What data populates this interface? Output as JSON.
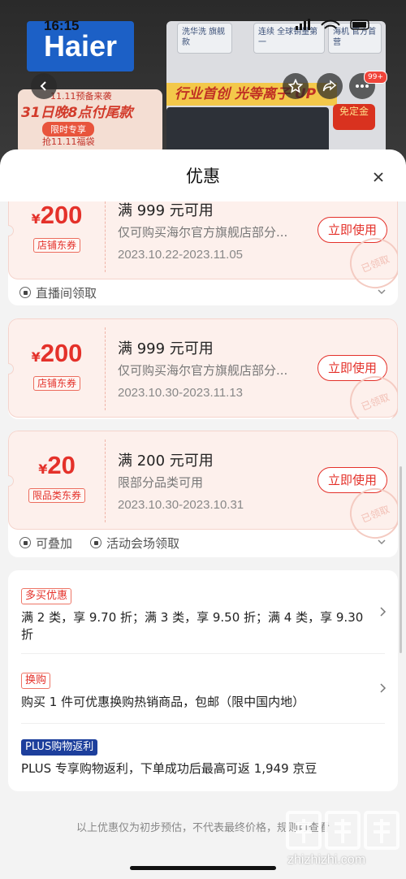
{
  "status_bar": {
    "time": "16:15"
  },
  "background": {
    "brand": "Haier",
    "promo_line1": "11.11预备来袭",
    "promo_line2": "31日晚8点付尾款",
    "promo_tag": "限时专享",
    "promo_line3": "抢11.11福袋",
    "tile1": "洗华洗 旗舰款",
    "tile2": "连续 全球销量第一",
    "tile3": "海机 官方首营",
    "slogan": "行业首创 光等离子 UP",
    "discount": "免定金",
    "badge": "99+"
  },
  "sheet": {
    "title": "优惠",
    "close_icon": "close-icon"
  },
  "coupons": [
    {
      "currency": "¥",
      "amount": "200",
      "tag": "店铺东券",
      "condition": "满 999 元可用",
      "desc": "仅可购买海尔官方旗舰店部分...",
      "date": "2023.10.22-2023.11.05",
      "action": "立即使用",
      "stamp": "已领取"
    },
    {
      "currency": "¥",
      "amount": "200",
      "tag": "店铺东券",
      "condition": "满 999 元可用",
      "desc": "仅可购买海尔官方旗舰店部分...",
      "date": "2023.10.30-2023.11.13",
      "action": "立即使用",
      "stamp": "已领取"
    },
    {
      "currency": "¥",
      "amount": "20",
      "tag": "限品类东券",
      "condition": "满 200 元可用",
      "desc": "限部分品类可用",
      "date": "2023.10.30-2023.10.31",
      "action": "立即使用",
      "stamp": "已领取"
    }
  ],
  "footers": {
    "first": {
      "source": "直播间领取"
    },
    "third": {
      "stackable": "可叠加",
      "source": "活动会场领取"
    }
  },
  "promotions": [
    {
      "tag": "多买优惠",
      "text": "满 2 类，享 9.70 折；满 3 类，享 9.50 折；满 4 类，享 9.30 折"
    },
    {
      "tag": "换购",
      "text": "购买 1 件可优惠换购热销商品，包邮（限中国内地）"
    },
    {
      "tag": "PLUS购物返利",
      "text": "PLUS 专享购物返利，下单成功后最高可返 1,949 京豆"
    }
  ],
  "footnote": "以上优惠仅为初步预估，不代表最终价格，规则可查看",
  "watermark": "zhizhizhi.com",
  "colors": {
    "accent": "#e4312a",
    "plus": "#1d3f9c",
    "coupon_bg": "#fdf0ec"
  }
}
